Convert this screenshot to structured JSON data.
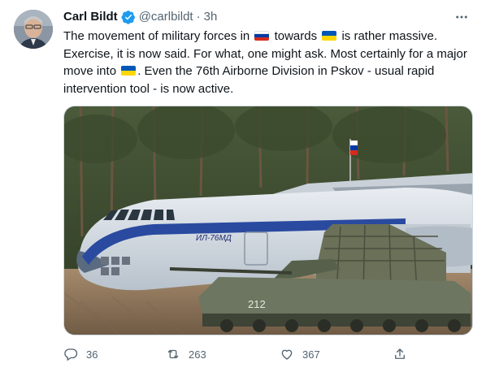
{
  "user": {
    "display_name": "Carl Bildt",
    "handle": "@carlbildt",
    "separator": "·",
    "time": "3h",
    "verified": true
  },
  "tweet": {
    "text_parts": [
      "The movement of military forces in ",
      " towards ",
      " is rather massive. Exercise, it is now said. For what, one might ask. Most certainly for a major move into ",
      ". Even the 76th Airborne Division in Pskov - usual rapid intervention tool - is now active."
    ],
    "flags": [
      "russia-flag",
      "ukraine-flag",
      "ukraine-flag"
    ]
  },
  "media": {
    "aircraft_marking": "ИЛ-76МД",
    "vehicle_number": "212"
  },
  "actions": {
    "reply_count": "36",
    "retweet_count": "263",
    "like_count": "367"
  },
  "icons": [
    "verified-badge-icon",
    "more-options-icon",
    "reply-icon",
    "retweet-icon",
    "like-icon",
    "share-icon"
  ],
  "colors": {
    "text": "#0f1419",
    "secondary": "#536471",
    "verified": "#1d9bf0",
    "russia": [
      "#ffffff",
      "#0039a6",
      "#d52b1e"
    ],
    "ukraine": [
      "#0057b7",
      "#ffd700"
    ]
  }
}
